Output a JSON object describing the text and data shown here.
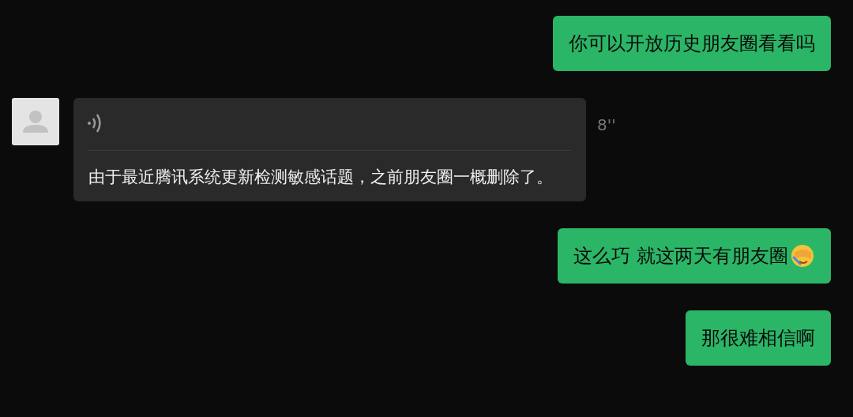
{
  "messages": [
    {
      "kind": "text",
      "text": "你可以开放历史朋友圈看看吗"
    },
    {
      "kind": "voice",
      "duration": "8''",
      "transcript": "由于最近腾讯系统更新检测敏感话题，之前朋友圈一概删除了。"
    },
    {
      "kind": "text",
      "text": "这么巧 就这两天有朋友圈",
      "emoji": true
    },
    {
      "kind": "text",
      "text": "那很难相信啊"
    }
  ]
}
